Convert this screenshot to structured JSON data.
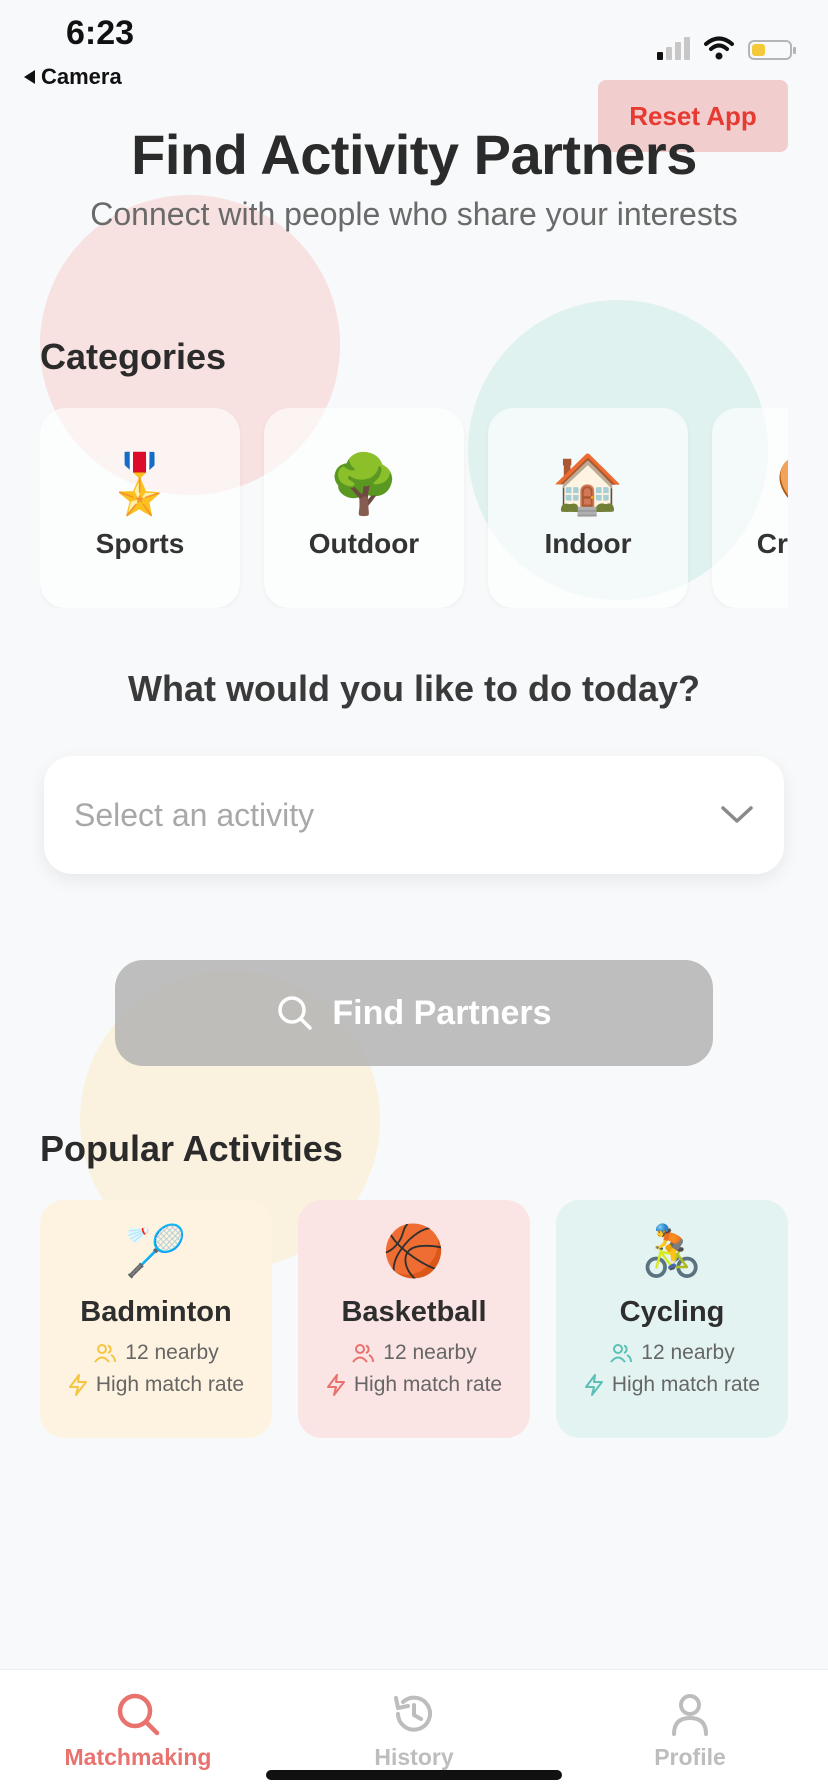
{
  "status_bar": {
    "time": "6:23",
    "back_label": "Camera",
    "battery_level": 0.35
  },
  "header": {
    "reset_label": "Reset App",
    "title": "Find Activity Partners",
    "subtitle": "Connect with people who share your interests"
  },
  "categories": {
    "title": "Categories",
    "items": [
      {
        "emoji": "🎖️",
        "label": "Sports"
      },
      {
        "emoji": "🌳",
        "label": "Outdoor"
      },
      {
        "emoji": "🏠",
        "label": "Indoor"
      },
      {
        "emoji": "🎨",
        "label": "Creative"
      }
    ]
  },
  "activity_select": {
    "question": "What would you like to do today?",
    "placeholder": "Select an activity"
  },
  "find_button": {
    "label": "Find Partners"
  },
  "popular": {
    "title": "Popular Activities",
    "items": [
      {
        "emoji": "🏸",
        "name": "Badminton",
        "nearby": "12 nearby",
        "rate": "High match rate",
        "bg": "#fdf3e0",
        "accent": "#f5c542"
      },
      {
        "emoji": "🏀",
        "name": "Basketball",
        "nearby": "12 nearby",
        "rate": "High match rate",
        "bg": "#fbe4e4",
        "accent": "#e8726e"
      },
      {
        "emoji": "🚴",
        "name": "Cycling",
        "nearby": "12 nearby",
        "rate": "High match rate",
        "bg": "#e3f3f2",
        "accent": "#5bc0b5"
      }
    ]
  },
  "tabbar": {
    "items": [
      {
        "label": "Matchmaking",
        "icon": "search-icon",
        "active": true
      },
      {
        "label": "History",
        "icon": "history-icon",
        "active": false
      },
      {
        "label": "Profile",
        "icon": "profile-icon",
        "active": false
      }
    ]
  },
  "colors": {
    "accent": "#e8726e",
    "reset_text": "#e53b32"
  }
}
